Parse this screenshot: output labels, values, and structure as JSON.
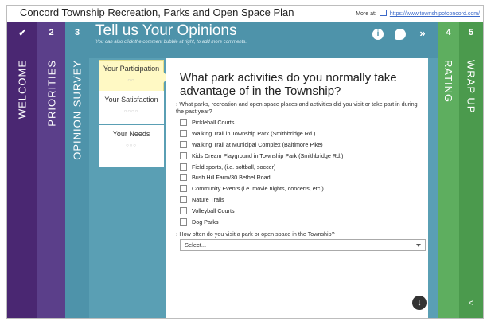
{
  "app": {
    "title": "Concord Township Recreation, Parks and Open Space Plan",
    "more_at_label": "More at:",
    "more_at_link": "https://www.townshipofconcord.com/"
  },
  "steps": [
    {
      "num": "✔",
      "label": "WELCOME"
    },
    {
      "num": "2",
      "label": "PRIORITIES"
    },
    {
      "num": "3",
      "label": "OPINION SURVEY"
    },
    {
      "num": "4",
      "label": "RATING"
    },
    {
      "num": "5",
      "label": "WRAP UP"
    }
  ],
  "survey": {
    "title": "Tell us Your Opinions",
    "subtitle": "You can also click the comment bubble at right, to add more comments."
  },
  "tabs": [
    {
      "label": "Your Participation",
      "dots": "○○"
    },
    {
      "label": "Your Satisfaction",
      "dots": "○○○○"
    },
    {
      "label": "Your Needs",
      "dots": "○○○"
    }
  ],
  "question": {
    "heading": "What park activities do you normally take advantage of in the Township?",
    "prompt1": "What parks, recreation and open space places and activities did you visit or take part in during the past year?",
    "options": [
      "Pickleball Courts",
      "Walking Trail in Township Park (Smithbridge Rd.)",
      "Walking Trail at Municipal Complex (Baltimore Pike)",
      "Kids Dream Playground in Township Park (Smithbridge Rd.)",
      "Field sports, (i.e. softball, soccer)",
      "Bush Hill Farm/30 Bethel Road",
      "Community Events (i.e. movie nights, concerts, etc.)",
      "Nature Trails",
      "Volleyball Courts",
      "Dog Parks"
    ],
    "prompt2": "How often do you visit a park or open space in the Township?",
    "select_value": "Select..."
  },
  "colors": {
    "welcome": "#4a2772",
    "priorities": "#5b3f8a",
    "survey": "#4e93aa",
    "rating": "#5eae5f",
    "wrapup": "#4b9a4d"
  }
}
